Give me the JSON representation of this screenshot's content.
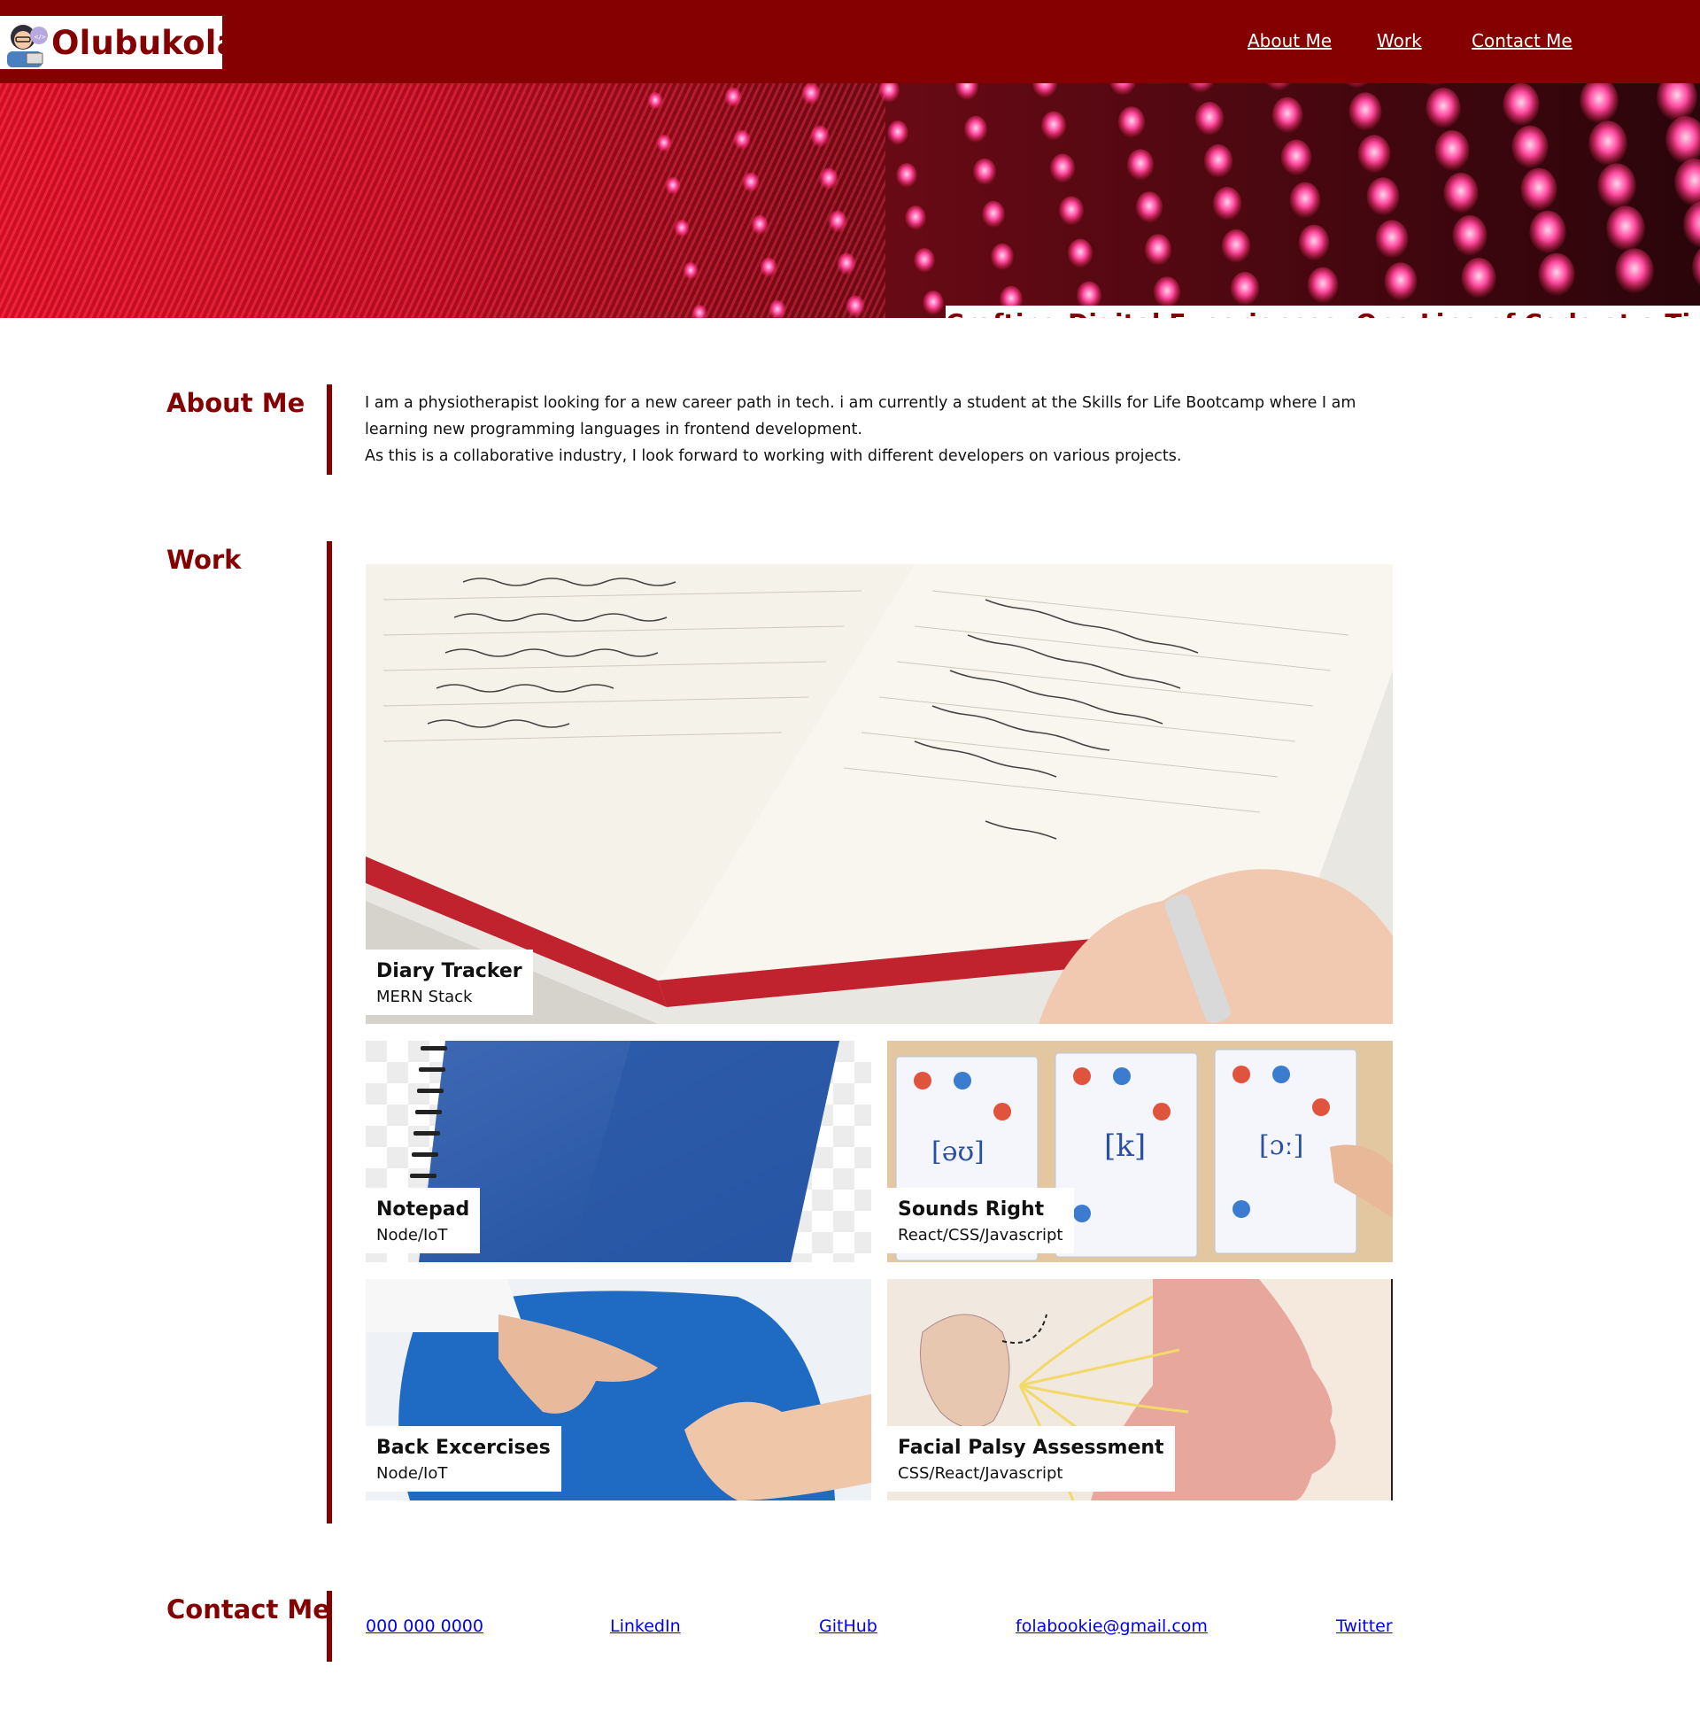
{
  "header": {
    "logo_text": "Olubukola",
    "nav": [
      "About Me",
      "Work",
      "Contact Me"
    ]
  },
  "hero": {
    "tagline": "Crafting Digital Experiences, One Line of Code at a Time"
  },
  "about": {
    "title": "About Me",
    "line1": "I am a physiotherapist looking for a new career path in tech. i am currently a student at the Skills for Life Bootcamp where I am learning new programming languages in frontend development.",
    "line2": "As this is a collaborative industry, I look forward to working with different developers on various projects."
  },
  "work": {
    "title": "Work",
    "projects": [
      {
        "title": "Diary Tracker",
        "stack": "MERN Stack",
        "image": "open-diary-photo"
      },
      {
        "title": "Notepad",
        "stack": "Node/IoT",
        "image": "blue-notebook-photo"
      },
      {
        "title": "Sounds Right",
        "stack": "React/CSS/Javascript",
        "image": "phonics-cards-photo"
      },
      {
        "title": "Back Excercises",
        "stack": "Node/IoT",
        "image": "back-massage-photo"
      },
      {
        "title": "Facial Palsy Assessment",
        "stack": "CSS/React/Javascript",
        "image": "facial-nerve-illustration"
      }
    ]
  },
  "contact": {
    "title": "Contact Me",
    "links": [
      "000 000 0000",
      "LinkedIn",
      "GitHub",
      "folabookie@gmail.com",
      "Twitter"
    ]
  },
  "colors": {
    "brand": "#850000",
    "link": "#0000ee"
  }
}
